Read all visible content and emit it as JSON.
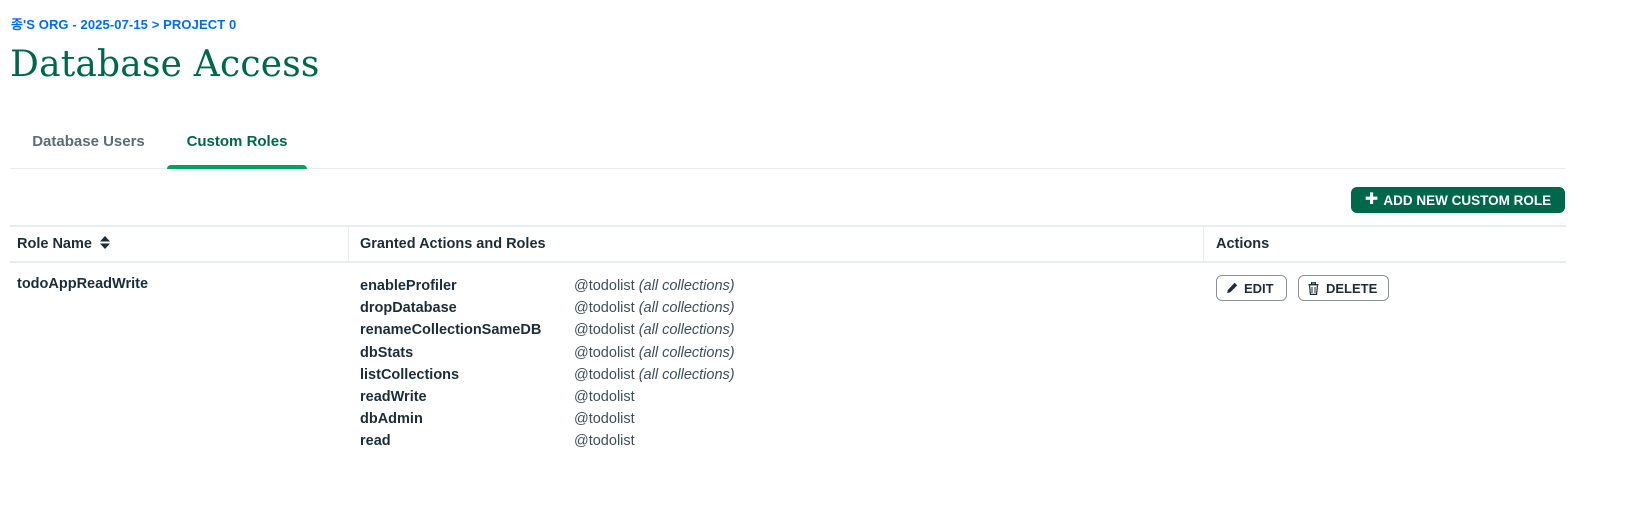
{
  "breadcrumb": {
    "org": "종'S ORG - 2025-07-15",
    "separator": ">",
    "project": "PROJECT 0"
  },
  "page": {
    "title": "Database Access"
  },
  "tabs": [
    {
      "label": "Database Users",
      "active": false
    },
    {
      "label": "Custom Roles",
      "active": true
    }
  ],
  "toolbar": {
    "add_label": "ADD NEW CUSTOM ROLE",
    "add_icon": "plus-icon"
  },
  "table": {
    "columns": [
      "Role Name",
      "Granted Actions and Roles",
      "Actions"
    ],
    "rows": [
      {
        "role_name": "todoAppReadWrite",
        "grants": [
          {
            "action": "enableProfiler",
            "db": "@todolist",
            "scope": "(all collections)"
          },
          {
            "action": "dropDatabase",
            "db": "@todolist",
            "scope": "(all collections)"
          },
          {
            "action": "renameCollectionSameDB",
            "db": "@todolist",
            "scope": "(all collections)"
          },
          {
            "action": "dbStats",
            "db": "@todolist",
            "scope": "(all collections)"
          },
          {
            "action": "listCollections",
            "db": "@todolist",
            "scope": "(all collections)"
          },
          {
            "action": "readWrite",
            "db": "@todolist",
            "scope": ""
          },
          {
            "action": "dbAdmin",
            "db": "@todolist",
            "scope": ""
          },
          {
            "action": "read",
            "db": "@todolist",
            "scope": ""
          }
        ],
        "edit_label": "EDIT",
        "delete_label": "DELETE"
      }
    ]
  },
  "colors": {
    "brand_green": "#00684a",
    "tab_underline": "#00a35c",
    "breadcrumb_blue": "#016bf8"
  }
}
